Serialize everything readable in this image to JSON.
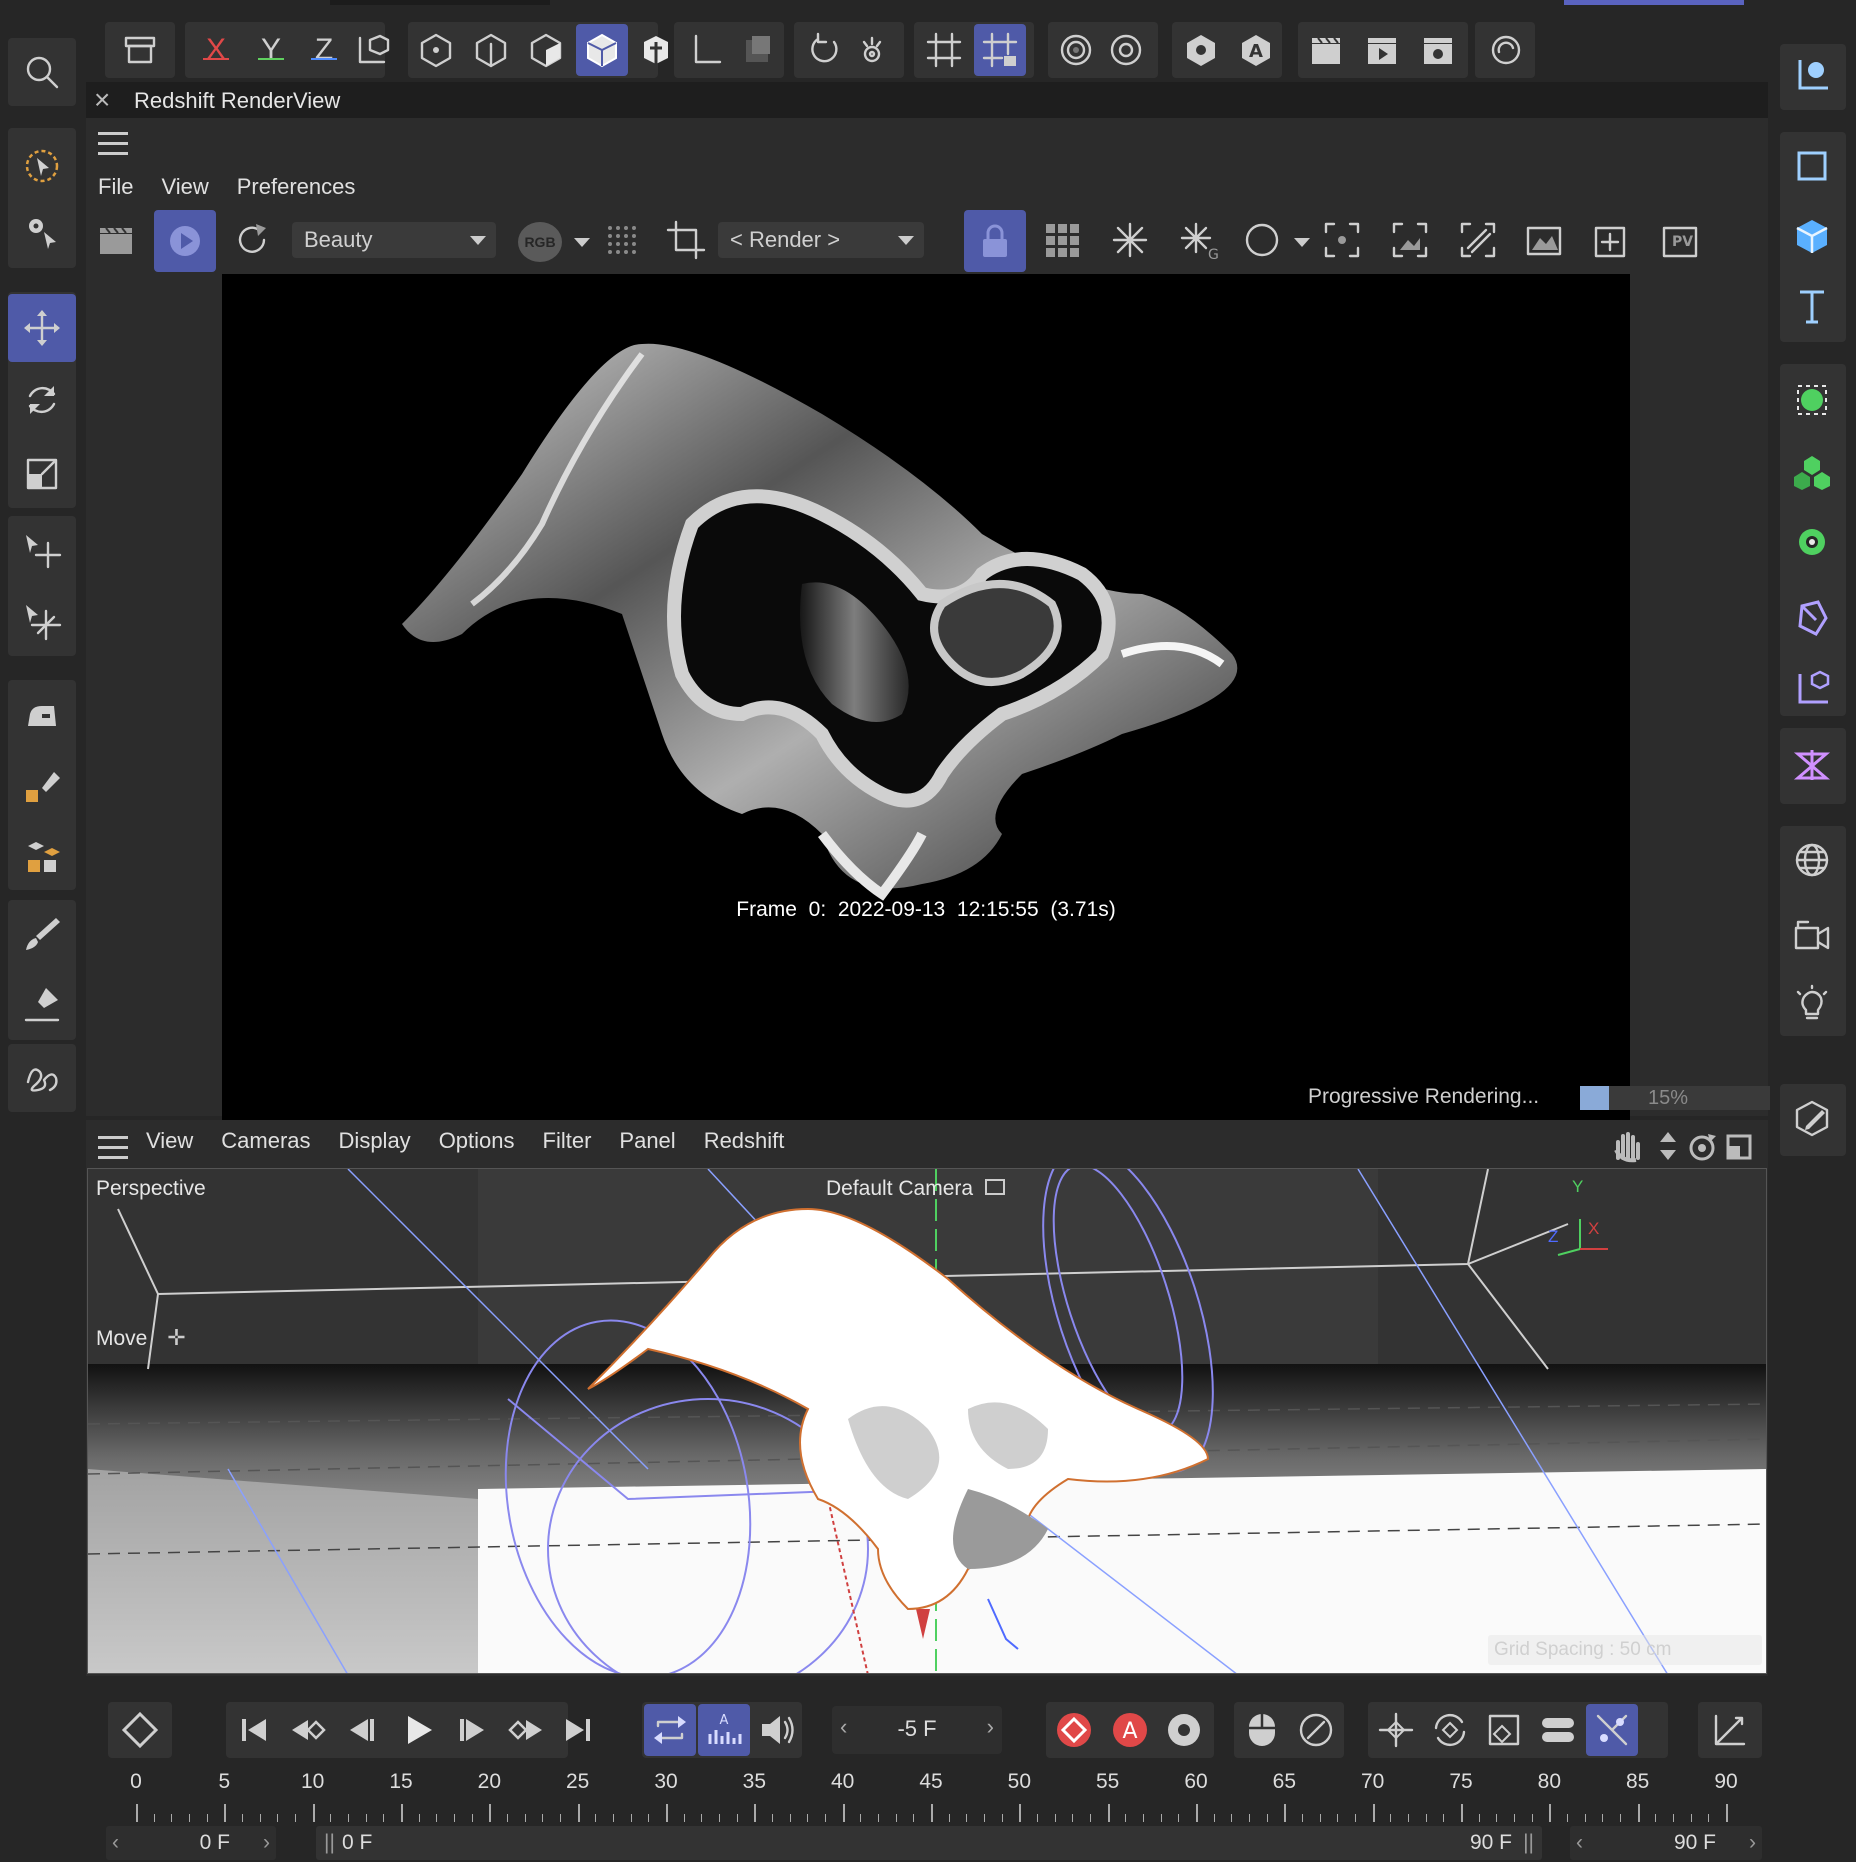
{
  "top_toolbar": {
    "axis_x": "X",
    "axis_y": "Y",
    "axis_z": "Z",
    "colors": {
      "x": "#e04848",
      "y": "#5fd05f",
      "z": "#4f8cff",
      "selected": "#4f5aa8"
    }
  },
  "renderview": {
    "title": "Redshift RenderView",
    "close_glyph": "×",
    "menu": [
      "File",
      "View",
      "Preferences"
    ],
    "aov_dropdown": "Beauty",
    "rgb_badge": "RGB",
    "render_dropdown": "< Render >",
    "pv_badge": "PV",
    "frame_info": "Frame  0:  2022-09-13  12:15:55  (3.71s)",
    "status_text": "Progressive Rendering...",
    "progress_value": 0.15,
    "progress_label": "15%"
  },
  "viewport": {
    "menu": [
      "View",
      "Cameras",
      "Display",
      "Options",
      "Filter",
      "Panel",
      "Redshift"
    ],
    "view_label": "Perspective",
    "camera_label": "Default Camera",
    "tool_label": "Move",
    "grid_spacing": "Grid Spacing : 50 cm",
    "axis_labels": {
      "y": "Y",
      "x": "X",
      "z": "Z"
    }
  },
  "timeline": {
    "current_frame": "-5 F",
    "ruler_marks": [
      "0",
      "5",
      "10",
      "15",
      "20",
      "25",
      "30",
      "35",
      "40",
      "45",
      "50",
      "55",
      "60",
      "65",
      "70",
      "75",
      "80",
      "85",
      "90"
    ],
    "start_field": "0 F",
    "range_start": "0 F",
    "range_end": "90 F",
    "end_field": "90 F",
    "record_glyph": "A"
  }
}
